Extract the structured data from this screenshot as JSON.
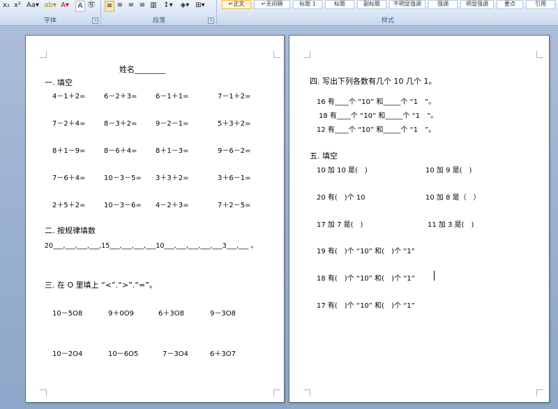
{
  "ribbon": {
    "font_group": {
      "label": "字体",
      "buttons": [
        "x₂",
        "x²",
        "Aa▾",
        "ab▾",
        "A▾",
        "A",
        "㊢"
      ]
    },
    "paragraph_group": {
      "label": "段落",
      "buttons": [
        "≡",
        "≡",
        "≡",
        "≡",
        "▥",
        "↕▾",
        "◈▾",
        "⊞▾"
      ]
    },
    "styles_group": {
      "label": "样式",
      "items": [
        "↵正文",
        "↵无间隔",
        "标题 1",
        "标题",
        "副标题",
        "不明显强调",
        "强调",
        "明显强调",
        "要点",
        "引用"
      ]
    }
  },
  "page1": {
    "name_line": "姓名________",
    "sec1_title": "一. 填空",
    "sec1_rows": [
      [
        "4－1＋2=",
        "6－2＋3=",
        "6－1＋1=",
        "7－1＋2="
      ],
      [
        "7－2＋4=",
        "8－3＋2=",
        "9－2－1=",
        "5＋3＋2="
      ],
      [
        "8＋1－9=",
        "8－6＋4=",
        "8＋1－3=",
        "9－6－2="
      ],
      [
        "7－6＋4=",
        "10－3－5=",
        "3＋3＋2=",
        "3＋6－1="
      ],
      [
        "2＋5＋2=",
        "10－3－6=",
        "4－2＋3=",
        "7＋2－5="
      ]
    ],
    "sec2_title": "二. 按规律填数",
    "sec2_line": "20___,___,___,___,15___,___,___,___10___,___,___,___,___3___,___ 。",
    "sec3_title": "三. 在 O 里填上 “<”.“>”.“=”。",
    "sec3_rows": [
      [
        "10－5O8",
        "9＋0O9",
        "6＋3O8",
        "9－3O8"
      ],
      [
        "10－2O4",
        "10－6O5",
        "7－3O4",
        "6＋3O7"
      ]
    ]
  },
  "page2": {
    "sec4_title": "四. 写出下列各数有几个 10 几个 1。",
    "sec4_lines": [
      "16 有____个 “10” 和_____个 “1　”。",
      "18 有____个 “10” 和_____个 “1　”。",
      "12 有____个 “10” 和_____个 “1　”。"
    ],
    "sec5_title": "五. 填空",
    "sec5_pairs": [
      [
        "10 加 10 是(　)",
        "10 加 9 是(　)"
      ],
      [
        "20 有(　)个 10",
        "10 加 8 是（　）"
      ],
      [
        "17 加 7 是(　)",
        "11 加 3 是(　)"
      ]
    ],
    "sec5_lines": [
      "19 有(　)个 “10” 和(　)个 “1”",
      "18 有(　)个 “10” 和(　)个 “1”",
      "17 有(　)个 “10” 和(　)个 “1”"
    ]
  }
}
